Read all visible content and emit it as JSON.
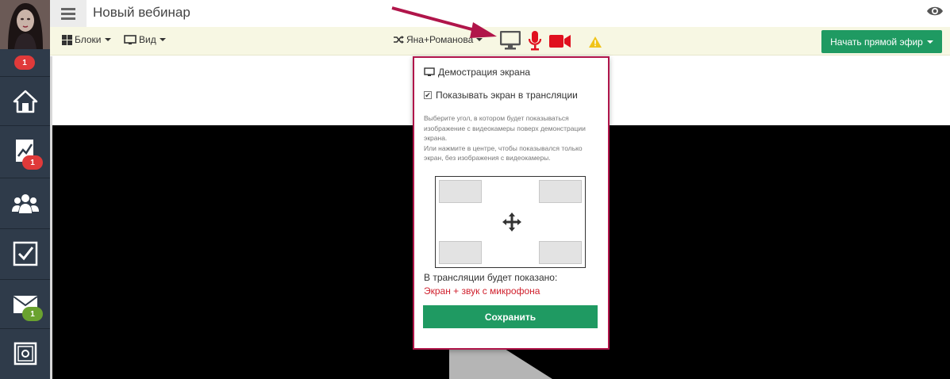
{
  "header": {
    "title": "Новый вебинар"
  },
  "sidebar": {
    "badges": {
      "avatar": "1",
      "stats": "1",
      "mail": "1"
    }
  },
  "toolbar": {
    "blocks_label": "Блоки",
    "view_label": "Вид",
    "presenter_label": "Яна+Романова",
    "start_live_label": "Начать прямой эфир"
  },
  "popup": {
    "title": "Демострация экрана",
    "show_screen_label": "Показывать экран в трансляции",
    "show_screen_checked": true,
    "help_text_1": "Выберите угол, в котором будет показываться изображение с видеокамеры поверх демонстрации экрана.",
    "help_text_2": "Или нажмите в центре, чтобы показывался только экран, без изображения с видеокамеры.",
    "result_label": "В трансляции будет показано:",
    "result_value": "Экран + звук с микрофона",
    "save_label": "Сохранить"
  },
  "colors": {
    "accent_green": "#1f9a62",
    "popup_border": "#b0154a",
    "mic_red": "#e0101e",
    "warning_yellow": "#f0c419",
    "sidebar_bg": "#2f3b4a"
  }
}
